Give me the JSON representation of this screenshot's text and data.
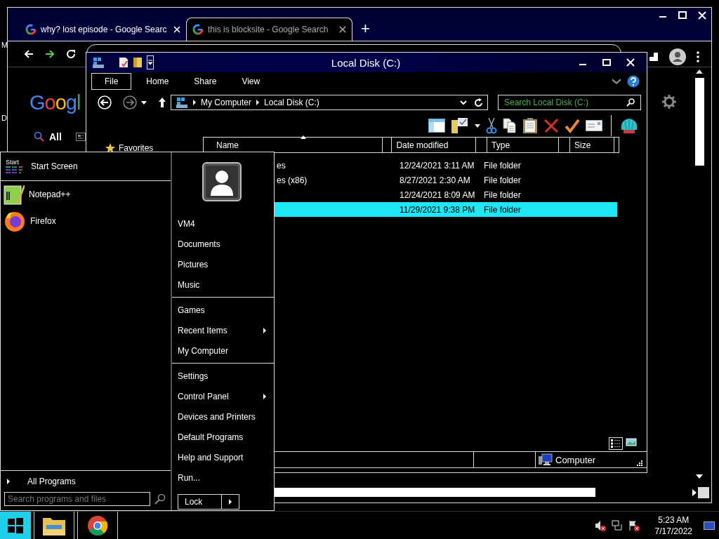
{
  "desktop_labels": [
    "M",
    "D"
  ],
  "browser": {
    "tabs": [
      {
        "title": "why? lost episode - Google Searc",
        "selected": false
      },
      {
        "title": "this is blocksite - Google Search",
        "selected": true
      }
    ],
    "new_tab": "+",
    "logo": "Googl",
    "search_tabs": [
      {
        "label": "All",
        "selected": true
      }
    ]
  },
  "explorer": {
    "title": "Local Disk (C:)",
    "ribbon_tabs": [
      {
        "label": "File",
        "selected": true
      },
      {
        "label": "Home",
        "selected": false
      },
      {
        "label": "Share",
        "selected": false
      },
      {
        "label": "View",
        "selected": false
      }
    ],
    "breadcrumb": [
      "My Computer",
      "Local Disk (C:)"
    ],
    "search": {
      "placeholder": "Search Local Disk (C:)"
    },
    "nav": [
      "Favorites"
    ],
    "columns": [
      "Name",
      "Date modified",
      "Type",
      "Size"
    ],
    "rows": [
      {
        "name": "es",
        "date": "12/24/2021 3:11 AM",
        "type": "File folder",
        "selected": false
      },
      {
        "name": "es (x86)",
        "date": "8/27/2021 2:30 AM",
        "type": "File folder",
        "selected": false
      },
      {
        "date": "12/24/2021 8:09 AM",
        "type": "File folder",
        "selected": false
      },
      {
        "date": "11/29/2021 9:38 PM",
        "type": "File folder",
        "selected": true
      }
    ],
    "status": "Computer"
  },
  "start_menu": {
    "tile_label": "Start",
    "header": "Start Screen",
    "programs": [
      {
        "name": "Notepad++",
        "kind": "notepad"
      },
      {
        "name": "Firefox",
        "kind": "firefox"
      }
    ],
    "all_programs": "All Programs",
    "search": {
      "placeholder": "Search programs and files"
    },
    "groups": [
      [
        {
          "label": "VM4",
          "submenu": false
        },
        {
          "label": "Documents",
          "submenu": false
        },
        {
          "label": "Pictures",
          "submenu": false
        },
        {
          "label": "Music",
          "submenu": false
        }
      ],
      [
        {
          "label": "Games",
          "submenu": false
        },
        {
          "label": "Recent Items",
          "submenu": true
        },
        {
          "label": "My Computer",
          "submenu": false
        }
      ],
      [
        {
          "label": "Settings",
          "submenu": false
        },
        {
          "label": "Control Panel",
          "submenu": true
        },
        {
          "label": "Devices and Printers",
          "submenu": false
        },
        {
          "label": "Default Programs",
          "submenu": false
        },
        {
          "label": "Help and Support",
          "submenu": false
        },
        {
          "label": "Run...",
          "submenu": false
        }
      ]
    ],
    "lock": "Lock"
  },
  "taskbar": {
    "time": "5:23 AM",
    "date": "7/17/2022"
  }
}
